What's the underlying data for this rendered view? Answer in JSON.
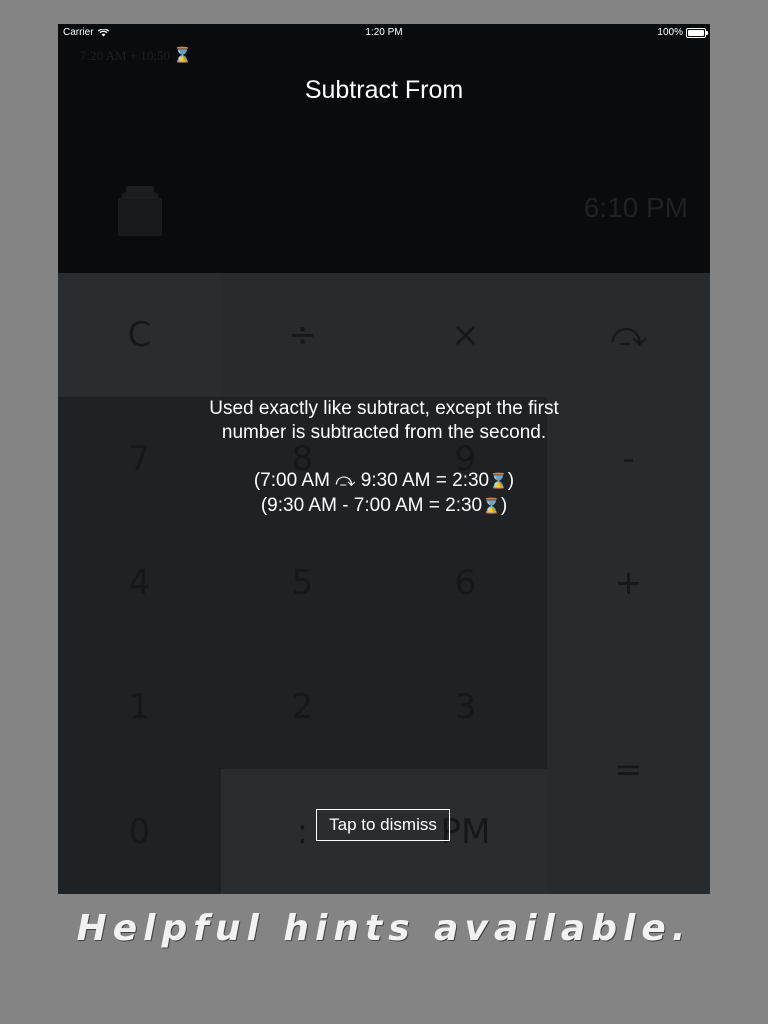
{
  "status_bar": {
    "carrier": "Carrier",
    "time": "1:20 PM",
    "battery": "100%"
  },
  "display": {
    "history": "7:20 AM   +   10:50",
    "result": "6:10 PM"
  },
  "keypad": {
    "keys": [
      "C",
      "÷",
      "×",
      "⤼",
      "7",
      "8",
      "9",
      "-",
      "4",
      "5",
      "6",
      "+",
      "1",
      "2",
      "3",
      "=",
      "0",
      ":",
      "PM"
    ]
  },
  "hint": {
    "title": "Subtract From",
    "line1": "Used exactly like subtract, except the first",
    "line2": "number is subtracted from the second.",
    "example1_text": "(7:00 AM ⤼ 9:30 AM = 2:30",
    "example2_text": "(9:30 AM - 7:00 AM = 2:30",
    "closing": ")",
    "dismiss_label": "Tap to dismiss"
  },
  "caption": "Helpful hints available.",
  "colors": {
    "background": "#848484",
    "display_bg": "#0a0b0c",
    "keypad_bg": "#222527",
    "text": "#ffffff",
    "hourglass": "#e2b87a"
  }
}
